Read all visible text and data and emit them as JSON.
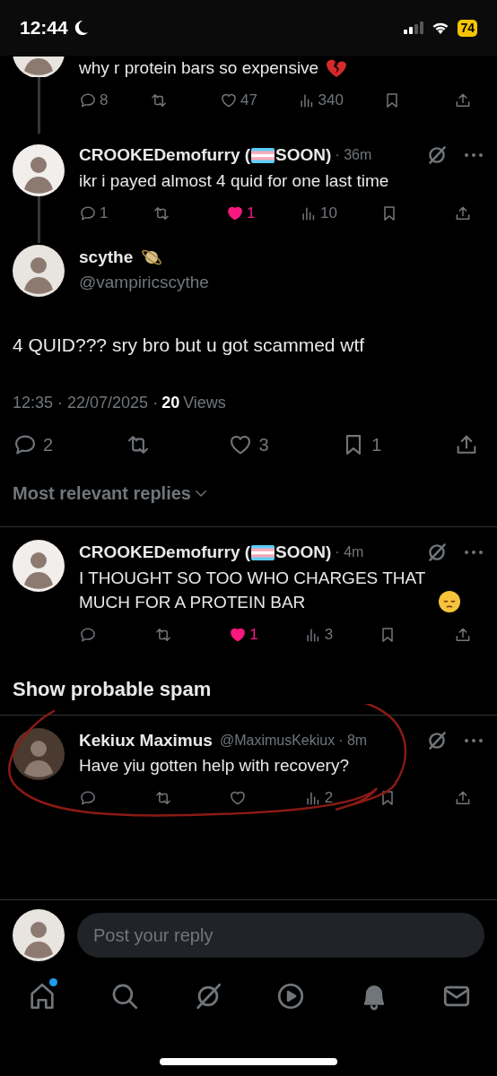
{
  "status_bar": {
    "time": "12:44",
    "battery": "74"
  },
  "thread": [
    {
      "body": "why r protein bars so expensive",
      "actions": [
        {
          "kind": "reply",
          "count": "8"
        },
        {
          "kind": "repost"
        },
        {
          "kind": "like",
          "count": "47",
          "liked": false
        },
        {
          "kind": "views",
          "count": "340"
        },
        {
          "kind": "bookmark"
        },
        {
          "kind": "share"
        }
      ]
    },
    {
      "name": "CROOKEDemofurry (",
      "name_suffix": "SOON)",
      "time": "· 36m",
      "body": "ikr i payed almost 4 quid for one last time",
      "actions": [
        {
          "kind": "reply",
          "count": "1"
        },
        {
          "kind": "repost"
        },
        {
          "kind": "like",
          "count": "1",
          "liked": true
        },
        {
          "kind": "views",
          "count": "10"
        },
        {
          "kind": "bookmark"
        },
        {
          "kind": "share"
        }
      ]
    }
  ],
  "main_post": {
    "name": "scythe",
    "handle": "@vampiricscythe",
    "body": "4 QUID??? sry bro but u got scammed wtf",
    "timestamp": "12:35 · 22/07/2025 ·",
    "views_count": "20",
    "views_label": "Views",
    "actions": [
      {
        "kind": "reply",
        "count": "2"
      },
      {
        "kind": "repost"
      },
      {
        "kind": "like",
        "count": "3",
        "liked": false
      },
      {
        "kind": "bookmark",
        "count": "1"
      },
      {
        "kind": "share"
      }
    ]
  },
  "sort_label": "Most relevant replies",
  "replies": [
    {
      "name": "CROOKEDemofurry (",
      "name_suffix": "SOON)",
      "time": "· 4m",
      "body": "I THOUGHT SO TOO WHO CHARGES THAT MUCH FOR A PROTEIN BAR",
      "actions": [
        {
          "kind": "reply"
        },
        {
          "kind": "repost"
        },
        {
          "kind": "like",
          "count": "1",
          "liked": true
        },
        {
          "kind": "views",
          "count": "3"
        },
        {
          "kind": "bookmark"
        },
        {
          "kind": "share"
        }
      ]
    }
  ],
  "spam_header": "Show probable spam",
  "spam_replies": [
    {
      "name": "Kekiux Maximus",
      "handle": "@MaximusKekiux",
      "time": "· 8m",
      "body": "Have yiu gotten help with recovery?",
      "actions": [
        {
          "kind": "reply"
        },
        {
          "kind": "repost"
        },
        {
          "kind": "like",
          "liked": false
        },
        {
          "kind": "views",
          "count": "2"
        },
        {
          "kind": "bookmark"
        },
        {
          "kind": "share"
        }
      ]
    }
  ],
  "reply_field": {
    "placeholder": "Post your reply"
  },
  "nav": [
    {
      "kind": "home",
      "notification": true
    },
    {
      "kind": "search",
      "notification": false
    },
    {
      "kind": "grok",
      "notification": false
    },
    {
      "kind": "video",
      "notification": false
    },
    {
      "kind": "notifications",
      "notification": false
    },
    {
      "kind": "messages",
      "notification": false
    }
  ]
}
